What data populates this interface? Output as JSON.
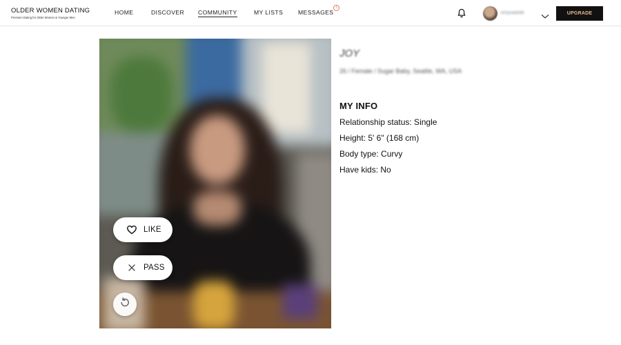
{
  "brand": {
    "title": "OLDER WOMEN DATING",
    "tagline": "Premium Dating for Older Women & Younger Men"
  },
  "nav": {
    "items": [
      {
        "label": "HOME"
      },
      {
        "label": "DISCOVER"
      },
      {
        "label": "COMMUNITY"
      },
      {
        "label": "MY LISTS"
      },
      {
        "label": "MESSAGES"
      }
    ],
    "active": "COMMUNITY",
    "messages_badge": "1"
  },
  "header": {
    "bell_icon": "bell-icon",
    "username": "ercysaaride",
    "dropdown_icon": "chevron-down-icon",
    "upgrade_label": "UPGRADE",
    "upgrade_text_color": "#e8b98a",
    "upgrade_bg_color": "#111111"
  },
  "profile": {
    "name": "JOY",
    "meta": "26 / Female / Sugar Baby, Seattle, WA, USA",
    "info_heading": "MY INFO",
    "info_lines": [
      "Relationship status: Single",
      "Height: 5' 6\" (168 cm)",
      "Body type: Curvy",
      "Have kids: No"
    ]
  },
  "actions": {
    "like_label": "LIKE",
    "like_icon": "heart-icon",
    "pass_label": "PASS",
    "pass_icon": "close-icon",
    "undo_icon": "undo-icon"
  }
}
